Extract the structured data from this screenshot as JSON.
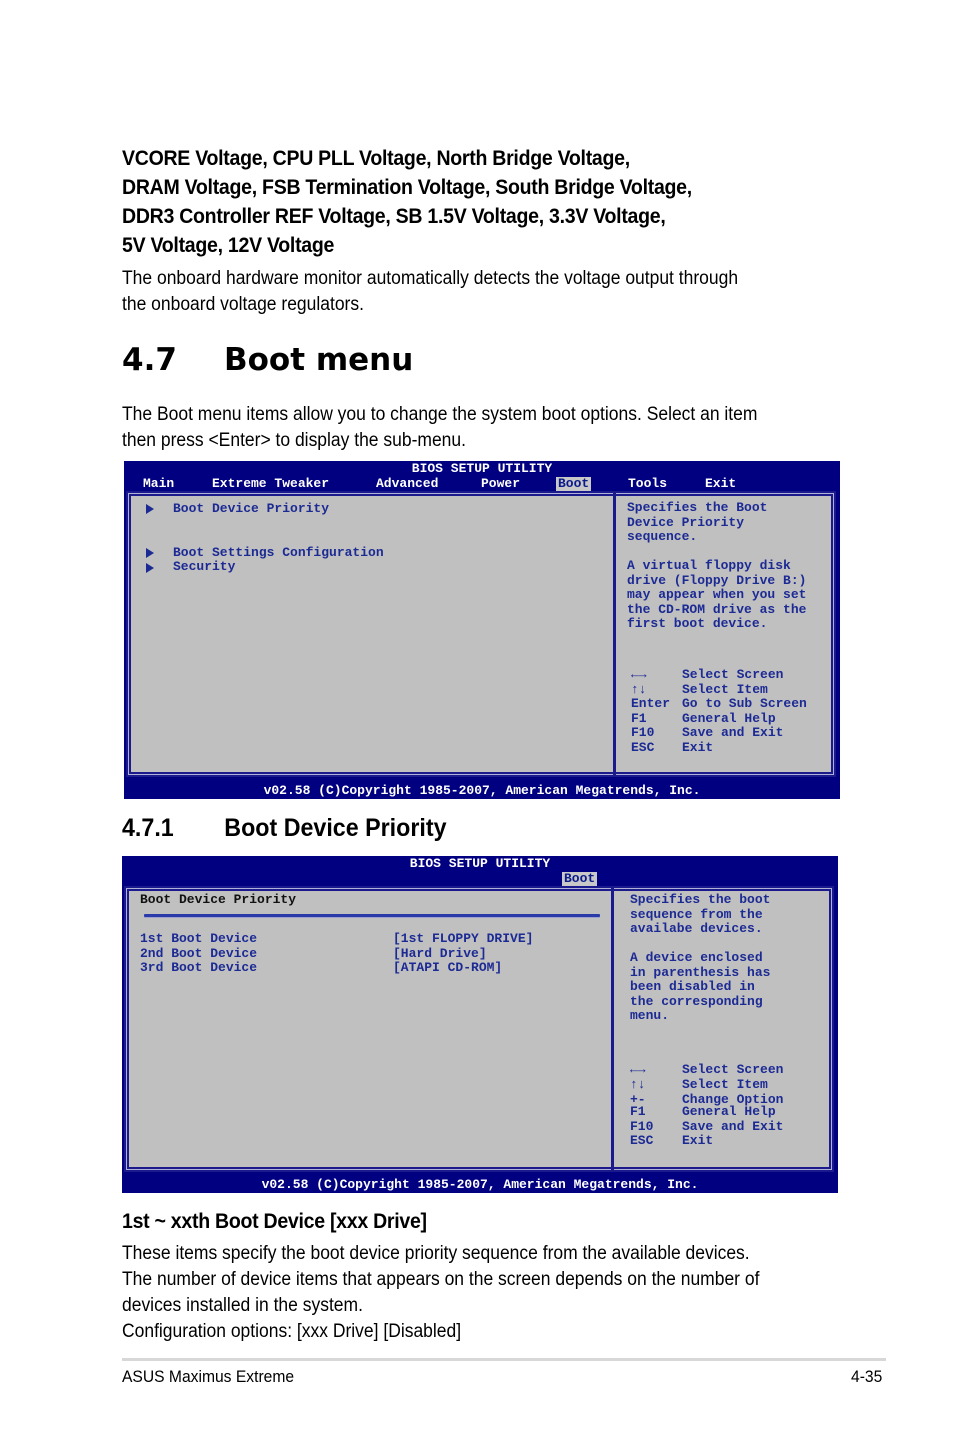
{
  "voltage_section": {
    "heading_lines": [
      "VCORE Voltage, CPU PLL Voltage, North Bridge Voltage,",
      "DRAM Voltage, FSB Termination Voltage, South Bridge Voltage,",
      "DDR3 Controller REF Voltage, SB 1.5V Voltage, 3.3V Voltage,",
      "5V Voltage, 12V Voltage"
    ],
    "body_lines": [
      "The onboard hardware monitor automatically detects the voltage output through",
      "the onboard voltage regulators."
    ]
  },
  "section_4_7": {
    "number": "4.7",
    "title": "Boot menu",
    "body_lines": [
      "The Boot menu items allow you to change the system boot options. Select an item",
      "then press <Enter> to display the sub-menu."
    ]
  },
  "bios1": {
    "title": "BIOS SETUP UTILITY",
    "menu": [
      "Main",
      "Extreme Tweaker",
      "Advanced",
      "Power",
      "Boot",
      "Tools",
      "Exit"
    ],
    "active_menu": "Boot",
    "items": [
      "Boot Device Priority",
      "Boot Settings Configuration",
      "Security"
    ],
    "help_lines": [
      "Specifies the Boot",
      "Device Priority",
      "sequence.",
      "",
      "A virtual floppy disk",
      "drive (Floppy Drive B:)",
      "may appear when you set",
      "the CD-ROM drive as the",
      "first boot device."
    ],
    "keys": [
      {
        "key_icon": "left-right-arrows-icon",
        "key": "",
        "action": "Select Screen"
      },
      {
        "key_icon": "up-down-arrows-icon",
        "key": "",
        "action": "Select Item"
      },
      {
        "key": "Enter",
        "action": "Go to Sub Screen"
      },
      {
        "key": "F1",
        "action": "General Help"
      },
      {
        "key": "F10",
        "action": "Save and Exit"
      },
      {
        "key": "ESC",
        "action": "Exit"
      }
    ],
    "footer": "v02.58 (C)Copyright 1985-2007, American Megatrends, Inc.",
    "colors": {
      "frame": "#000080",
      "panel": "#c0c0c0",
      "text": "#1c2a94"
    }
  },
  "section_4_7_1": {
    "number": "4.7.1",
    "title": "Boot Device Priority"
  },
  "bios2": {
    "title": "BIOS SETUP UTILITY",
    "active_menu": "Boot",
    "panel_title": "Boot Device Priority",
    "devices": [
      {
        "label": "1st Boot Device",
        "value": "[1st FLOPPY DRIVE]"
      },
      {
        "label": "2nd Boot Device",
        "value": "[Hard Drive]"
      },
      {
        "label": "3rd Boot Device",
        "value": "[ATAPI CD-ROM]"
      }
    ],
    "help_lines": [
      "Specifies the boot",
      "sequence from the",
      "availabe devices.",
      "",
      "A device enclosed",
      "in parenthesis has",
      "been disabled in",
      "the corresponding",
      "menu."
    ],
    "keys": [
      {
        "key_icon": "left-right-arrows-icon",
        "key": "",
        "action": "Select Screen"
      },
      {
        "key_icon": "up-down-arrows-icon",
        "key": "",
        "action": "Select Item"
      },
      {
        "key": "+-",
        "action": "Change Option"
      },
      {
        "key": "F1",
        "action": "General Help"
      },
      {
        "key": "F10",
        "action": "Save and Exit"
      },
      {
        "key": "ESC",
        "action": "Exit"
      }
    ],
    "footer": "v02.58 (C)Copyright 1985-2007, American Megatrends, Inc."
  },
  "boot_device_section": {
    "heading": "1st ~ xxth Boot Device [xxx Drive]",
    "body_lines": [
      "These items specify the boot device priority sequence from the available devices.",
      "The number of device items that appears on the screen depends on the number of",
      "devices installed in the system.",
      "Configuration options: [xxx Drive] [Disabled]"
    ]
  },
  "page_footer": {
    "product": "ASUS Maximus Extreme",
    "page_number": "4-35"
  }
}
